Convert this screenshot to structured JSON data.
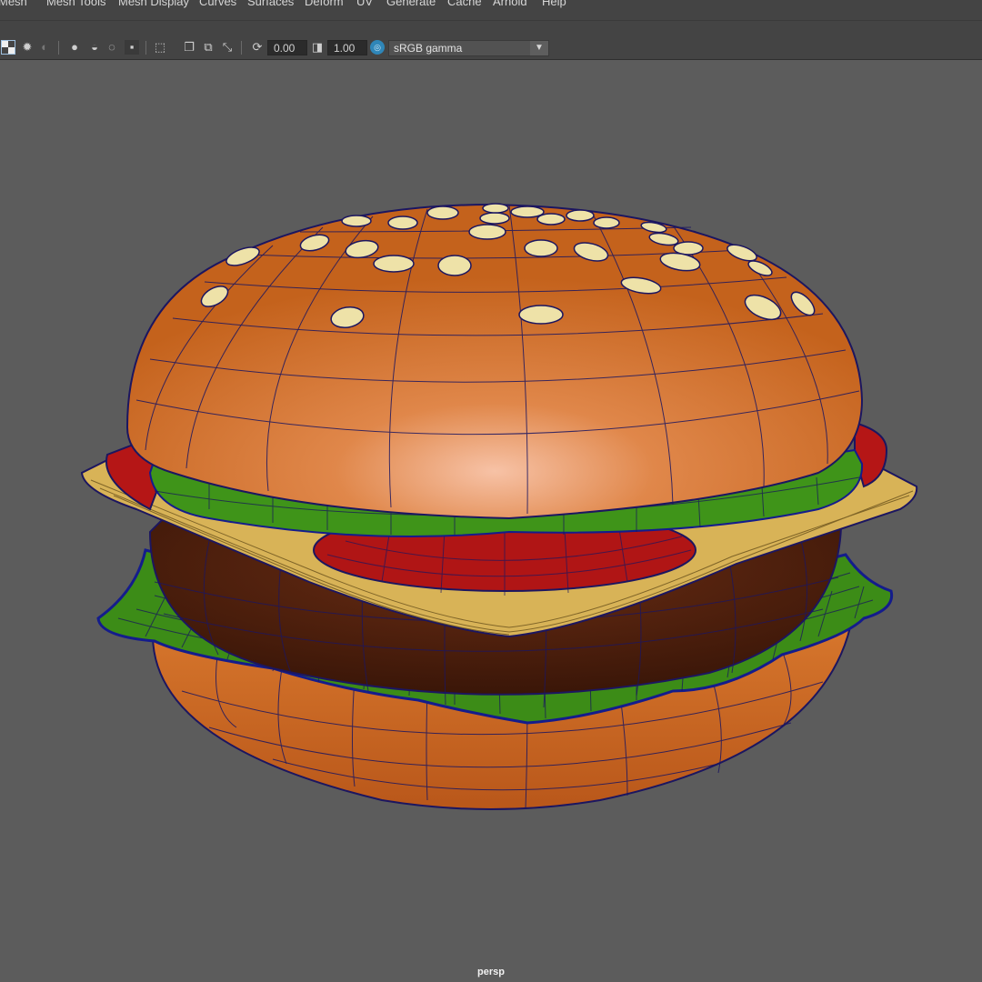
{
  "menubar": {
    "items": [
      "Mesh",
      "Mesh Tools",
      "Mesh Display",
      "Curves",
      "Surfaces",
      "Deform",
      "UV",
      "Generate",
      "Cache",
      "Arnold",
      "Help"
    ]
  },
  "toolbar": {
    "exposure_value": "0.00",
    "gamma_value": "1.00",
    "color_space": "sRGB gamma",
    "icons": [
      "checker-icon",
      "light-icon",
      "shadow-icon",
      "ao-icon",
      "motion-blur-icon",
      "xray-icon",
      "isolate-icon",
      "wireframe-icon",
      "xray-joint-icon",
      "frame-icon",
      "exposure-icon",
      "gamma-icon",
      "color-management-icon",
      "dropdown-arrow-icon"
    ]
  },
  "viewport": {
    "camera": "persp",
    "object": "hamburger-model"
  },
  "colors": {
    "bun": "#c8651e",
    "bun_highlight": "#f2b28f",
    "lettuce": "#3a8a16",
    "tomato": "#b01515",
    "cheese": "#d9b45a",
    "patty": "#4a1f0e",
    "seed": "#eee2a8",
    "wire": "#1c1660",
    "viewport_bg": "#5c5c5c"
  }
}
